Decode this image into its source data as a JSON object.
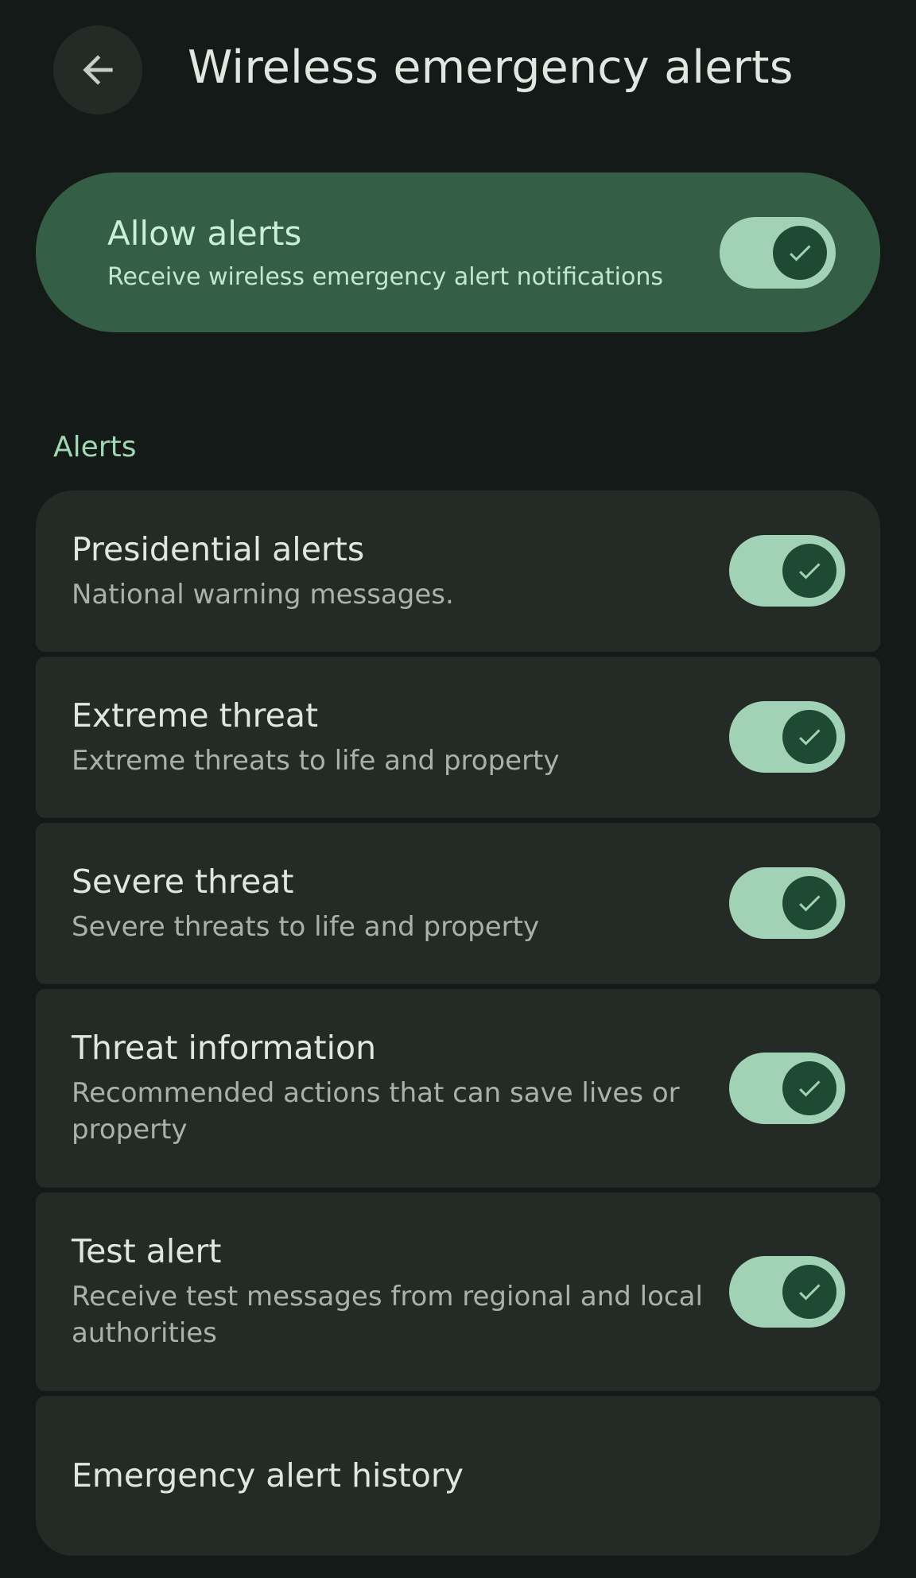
{
  "header": {
    "title": "Wireless emergency alerts",
    "back_icon": "arrow-back-icon"
  },
  "allow": {
    "title": "Allow alerts",
    "subtitle": "Receive wireless emergency alert notifications",
    "enabled": true
  },
  "section": {
    "title": "Alerts"
  },
  "alerts": [
    {
      "title": "Presidential alerts",
      "subtitle": "National warning messages.",
      "enabled": true
    },
    {
      "title": "Extreme threat",
      "subtitle": "Extreme threats to life and property",
      "enabled": true
    },
    {
      "title": "Severe threat",
      "subtitle": "Severe threats to life and property",
      "enabled": true
    },
    {
      "title": "Threat information",
      "subtitle": "Recommended actions that can save lives or property",
      "enabled": true
    },
    {
      "title": "Test alert",
      "subtitle": "Receive test messages from regional and local authorities",
      "enabled": true
    }
  ],
  "history": {
    "title": "Emergency alert history"
  },
  "colors": {
    "background": "#141a17",
    "card": "#242b27",
    "allow_card": "#355e46",
    "switch_track": "#a2d2b6",
    "switch_thumb": "#1e4a34",
    "accent_text": "#9fd8b2"
  }
}
